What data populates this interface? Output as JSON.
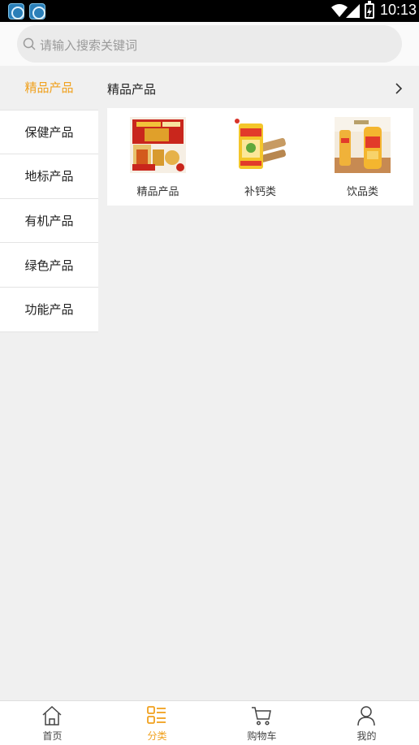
{
  "status_bar": {
    "time": "10:13"
  },
  "search": {
    "placeholder": "请输入搜索关键词"
  },
  "sidebar": {
    "items": [
      {
        "label": "精品产品",
        "active": true
      },
      {
        "label": "保健产品"
      },
      {
        "label": "地标产品"
      },
      {
        "label": "有机产品"
      },
      {
        "label": "绿色产品"
      },
      {
        "label": "功能产品"
      }
    ]
  },
  "main": {
    "section_title": "精品产品",
    "subcategories": [
      {
        "label": "精品产品",
        "image": "gift-box-product-image"
      },
      {
        "label": "补钙类",
        "image": "calcium-product-image"
      },
      {
        "label": "饮品类",
        "image": "beverage-product-image"
      }
    ]
  },
  "bottom_nav": {
    "items": [
      {
        "label": "首页",
        "icon": "home-icon"
      },
      {
        "label": "分类",
        "icon": "category-icon",
        "active": true
      },
      {
        "label": "购物车",
        "icon": "cart-icon"
      },
      {
        "label": "我的",
        "icon": "user-icon"
      }
    ]
  },
  "colors": {
    "accent": "#f0a11e",
    "background": "#f0f0f0"
  }
}
